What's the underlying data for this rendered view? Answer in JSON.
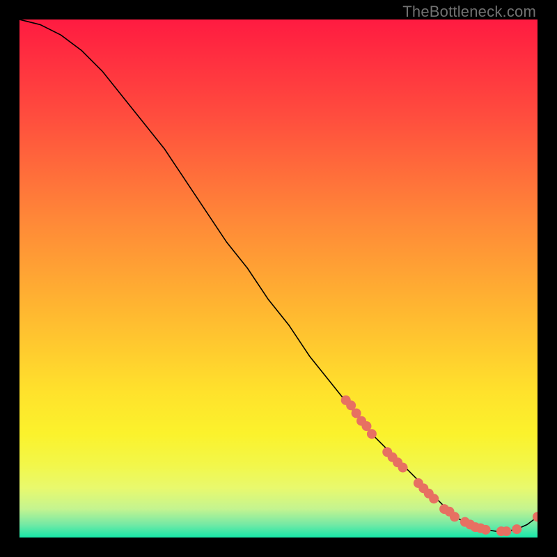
{
  "attribution": "TheBottleneck.com",
  "colors": {
    "dot": "#e77062",
    "line": "#000000"
  },
  "gradient_stops": [
    {
      "offset": 0.0,
      "color": "#ff1b41"
    },
    {
      "offset": 0.18,
      "color": "#ff4b3e"
    },
    {
      "offset": 0.38,
      "color": "#ff8638"
    },
    {
      "offset": 0.55,
      "color": "#ffb431"
    },
    {
      "offset": 0.72,
      "color": "#ffe22c"
    },
    {
      "offset": 0.8,
      "color": "#fbf22c"
    },
    {
      "offset": 0.86,
      "color": "#f2f74a"
    },
    {
      "offset": 0.905,
      "color": "#e8f96e"
    },
    {
      "offset": 0.945,
      "color": "#c4f490"
    },
    {
      "offset": 0.975,
      "color": "#74e9a5"
    },
    {
      "offset": 1.0,
      "color": "#17e8a9"
    }
  ],
  "chart_data": {
    "type": "line",
    "title": "",
    "xlabel": "",
    "ylabel": "",
    "xlim": [
      0,
      100
    ],
    "ylim": [
      0,
      100
    ],
    "annotations": [],
    "series": [
      {
        "name": "curve",
        "x": [
          0,
          4,
          8,
          12,
          16,
          20,
          24,
          28,
          32,
          36,
          40,
          44,
          48,
          52,
          56,
          60,
          64,
          68,
          72,
          76,
          80,
          82,
          84,
          86,
          88,
          90,
          92,
          94,
          96,
          98,
          100
        ],
        "y": [
          100,
          99,
          97,
          94,
          90,
          85,
          80,
          75,
          69,
          63,
          57,
          52,
          46,
          41,
          35,
          30,
          25,
          20,
          16,
          12,
          8,
          6,
          4,
          3,
          2,
          1.5,
          1.2,
          1.2,
          1.6,
          2.5,
          4
        ]
      }
    ],
    "dots": [
      {
        "x": 63,
        "y": 26.5
      },
      {
        "x": 64,
        "y": 25.5
      },
      {
        "x": 65,
        "y": 24
      },
      {
        "x": 66,
        "y": 22.5
      },
      {
        "x": 67,
        "y": 21.5
      },
      {
        "x": 68,
        "y": 20
      },
      {
        "x": 71,
        "y": 16.5
      },
      {
        "x": 72,
        "y": 15.5
      },
      {
        "x": 73,
        "y": 14.5
      },
      {
        "x": 74,
        "y": 13.5
      },
      {
        "x": 77,
        "y": 10.5
      },
      {
        "x": 78,
        "y": 9.5
      },
      {
        "x": 79,
        "y": 8.5
      },
      {
        "x": 80,
        "y": 7.5
      },
      {
        "x": 82,
        "y": 5.5
      },
      {
        "x": 83,
        "y": 5
      },
      {
        "x": 84,
        "y": 4
      },
      {
        "x": 86,
        "y": 3
      },
      {
        "x": 87,
        "y": 2.5
      },
      {
        "x": 88,
        "y": 2
      },
      {
        "x": 89,
        "y": 1.8
      },
      {
        "x": 90,
        "y": 1.5
      },
      {
        "x": 93,
        "y": 1.2
      },
      {
        "x": 94,
        "y": 1.2
      },
      {
        "x": 96,
        "y": 1.6
      },
      {
        "x": 100,
        "y": 4
      }
    ]
  }
}
